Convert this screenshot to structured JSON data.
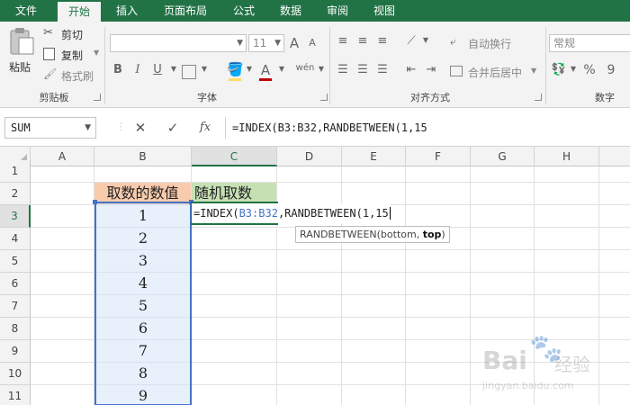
{
  "tabs": [
    "文件",
    "开始",
    "插入",
    "页面布局",
    "公式",
    "数据",
    "审阅",
    "视图"
  ],
  "ribbon": {
    "clipboard": {
      "paste": "粘贴",
      "cut": "剪切",
      "copy": "复制",
      "format_painter": "格式刷",
      "label": "剪贴板"
    },
    "font": {
      "size": "11",
      "grow": "A",
      "shrink": "A",
      "bold": "B",
      "italic": "I",
      "underline": "U",
      "font_color": "A",
      "phonetic": "wén",
      "label": "字体"
    },
    "alignment": {
      "wrap_text": "自动换行",
      "merge_center": "合并后居中",
      "label": "对齐方式"
    },
    "number": {
      "format": "常规",
      "percent": "%",
      "comma": "9",
      "label": "数字"
    }
  },
  "formula_bar": {
    "name_box": "SUM",
    "cancel": "✕",
    "enter": "✓",
    "fx": "fx",
    "formula": "=INDEX(B3:B32,RANDBETWEEN(1,15"
  },
  "columns": [
    "A",
    "B",
    "C",
    "D",
    "E",
    "F",
    "G",
    "H"
  ],
  "rows": [
    "1",
    "2",
    "3",
    "4",
    "5",
    "6",
    "7",
    "8",
    "9",
    "10",
    "11"
  ],
  "cells": {
    "B2": "取数的数值",
    "C2": "随机取数",
    "B_values": [
      "1",
      "2",
      "3",
      "4",
      "5",
      "6",
      "7",
      "8",
      "9"
    ]
  },
  "editing": {
    "prefix": "=INDEX(",
    "ref": "B3:B32",
    "suffix": ",RANDBETWEEN(1,15"
  },
  "tooltip": {
    "func": "RANDBETWEEN(bottom, ",
    "arg": "top",
    "close": ")"
  },
  "watermark": {
    "logo": "Bai",
    "text": "经验",
    "url": "jingyan.baidu.com"
  },
  "colors": {
    "excel_green": "#217346",
    "header_orange": "#f8cbad",
    "header_green": "#c6e0b4",
    "range_blue": "#4472c4"
  }
}
